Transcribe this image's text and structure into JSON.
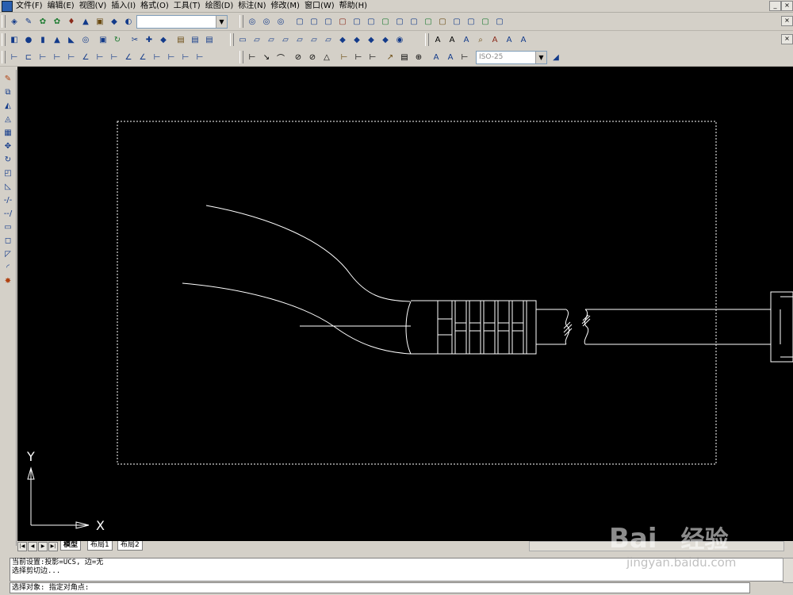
{
  "menu": {
    "items": [
      "文件(F)",
      "编辑(E)",
      "视图(V)",
      "插入(I)",
      "格式(O)",
      "工具(T)",
      "绘图(D)",
      "标注(N)",
      "修改(M)",
      "窗口(W)",
      "帮助(H)"
    ]
  },
  "toolbar": {
    "layer_combo_value": "",
    "dimstyle_combo_value": "ISO-25"
  },
  "canvas": {
    "background": "#000000",
    "ucs_x_label": "X",
    "ucs_y_label": "Y"
  },
  "tabs": {
    "items": [
      "模型",
      "布局1",
      "布局2"
    ]
  },
  "command": {
    "history_line1": "当前设置:投影=UCS, 边=无",
    "history_line2": "选择剪切边...",
    "prompt": "选择对象: 指定对角点:"
  },
  "watermark": {
    "brand": "Bai",
    "brand_tail": "经验",
    "url": "jingyan.baidu.com"
  }
}
